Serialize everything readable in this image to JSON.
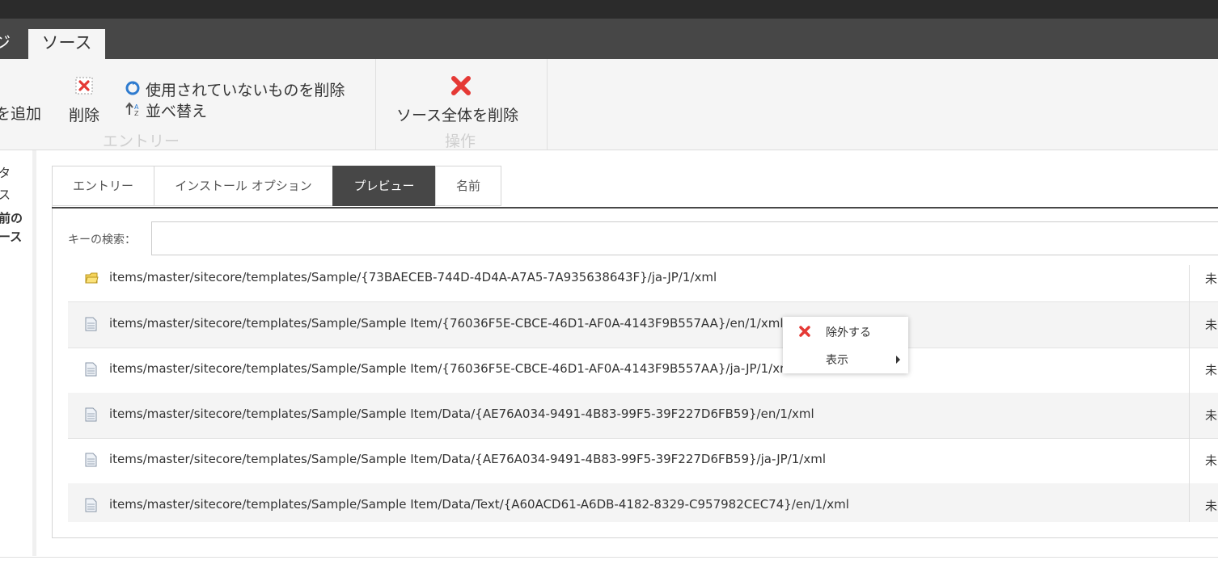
{
  "ribbon": {
    "tabs": [
      {
        "label": "ジ"
      },
      {
        "label": "ソース"
      }
    ],
    "add_label": "を追加",
    "delete_label": "削除",
    "remove_unused_label": "使用されていないものを削除",
    "sort_label": "並べ替え",
    "entry_group_label": "エントリー",
    "delete_all_label": "ソース全体を削除",
    "operation_group_label": "操作",
    "colors": {
      "delete_red": "#e53935",
      "refresh_blue": "#2e7bcf"
    }
  },
  "left_panel": {
    "items": [
      "タ",
      "ス",
      "前の",
      "ース"
    ]
  },
  "tabs": [
    {
      "label": "エントリー"
    },
    {
      "label": "インストール オプション"
    },
    {
      "label": "プレビュー"
    },
    {
      "label": "名前"
    }
  ],
  "search": {
    "label": "キーの検索：",
    "value": ""
  },
  "rows": [
    {
      "icon": "folder-icon",
      "path": "items/master/sitecore/templates/Sample/{73BAECEB-744D-4D4A-A7A5-7A935638643F}/ja-JP/1/xml",
      "status": "未"
    },
    {
      "icon": "document-icon",
      "path": "items/master/sitecore/templates/Sample/Sample Item/{76036F5E-CBCE-46D1-AF0A-4143F9B557AA}/en/1/xml",
      "status": "未"
    },
    {
      "icon": "document-icon",
      "path": "items/master/sitecore/templates/Sample/Sample Item/{76036F5E-CBCE-46D1-AF0A-4143F9B557AA}/ja-JP/1/xml",
      "status": "未"
    },
    {
      "icon": "document-icon",
      "path": "items/master/sitecore/templates/Sample/Sample Item/Data/{AE76A034-9491-4B83-99F5-39F227D6FB59}/en/1/xml",
      "status": "未"
    },
    {
      "icon": "document-icon",
      "path": "items/master/sitecore/templates/Sample/Sample Item/Data/{AE76A034-9491-4B83-99F5-39F227D6FB59}/ja-JP/1/xml",
      "status": "未"
    },
    {
      "icon": "document-icon",
      "path": "items/master/sitecore/templates/Sample/Sample Item/Data/Text/{A60ACD61-A6DB-4182-8329-C957982CEC74}/en/1/xml",
      "status": "未"
    }
  ],
  "context_menu": {
    "exclude_label": "除外する",
    "view_label": "表示"
  }
}
